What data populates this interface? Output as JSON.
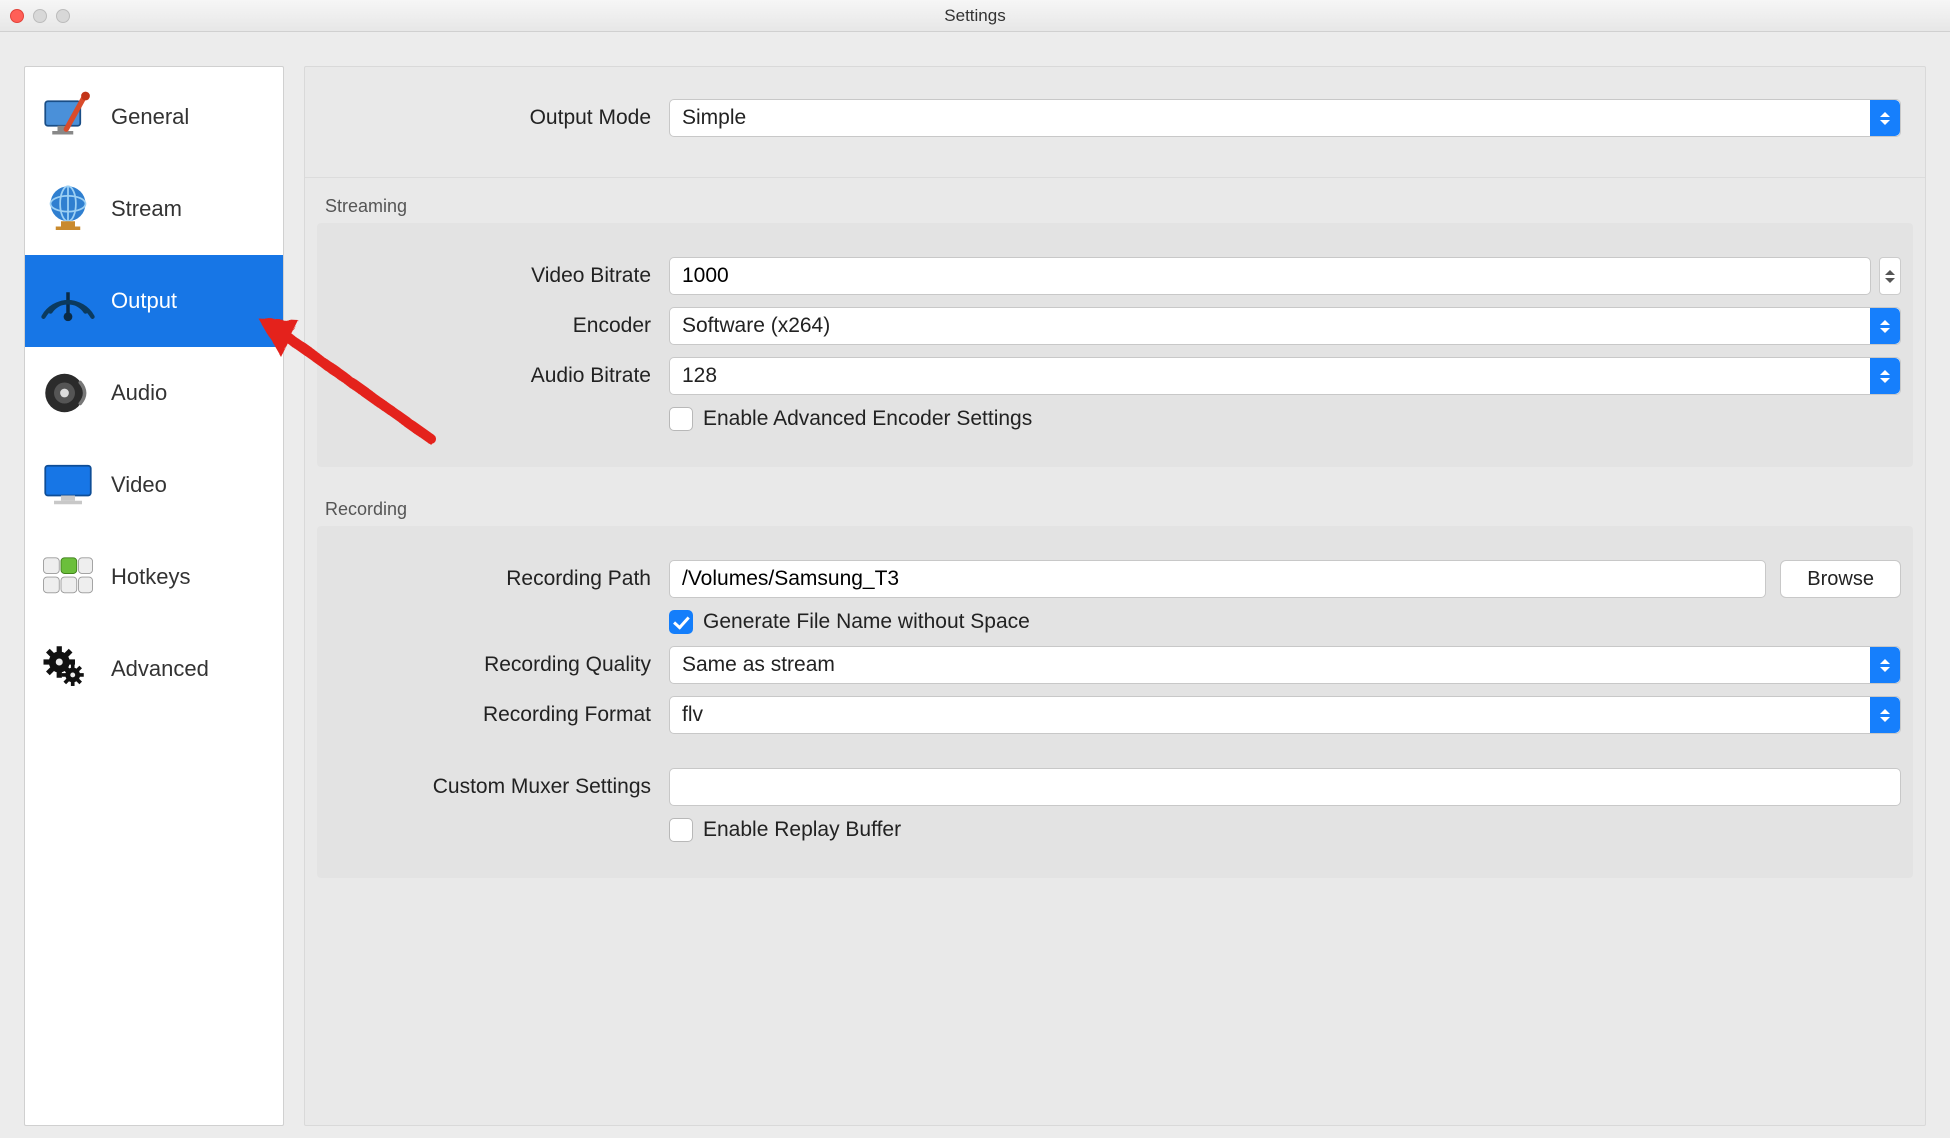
{
  "window": {
    "title": "Settings"
  },
  "sidebar": {
    "items": [
      {
        "label": "General"
      },
      {
        "label": "Stream"
      },
      {
        "label": "Output",
        "active": true
      },
      {
        "label": "Audio"
      },
      {
        "label": "Video"
      },
      {
        "label": "Hotkeys"
      },
      {
        "label": "Advanced"
      }
    ]
  },
  "output": {
    "output_mode_label": "Output Mode",
    "output_mode_value": "Simple",
    "streaming": {
      "title": "Streaming",
      "video_bitrate_label": "Video Bitrate",
      "video_bitrate_value": "1000",
      "encoder_label": "Encoder",
      "encoder_value": "Software (x264)",
      "audio_bitrate_label": "Audio Bitrate",
      "audio_bitrate_value": "128",
      "enable_advanced_label": "Enable Advanced Encoder Settings",
      "enable_advanced_checked": false
    },
    "recording": {
      "title": "Recording",
      "path_label": "Recording Path",
      "path_value": "/Volumes/Samsung_T3",
      "browse_label": "Browse",
      "gen_nospace_label": "Generate File Name without Space",
      "gen_nospace_checked": true,
      "quality_label": "Recording Quality",
      "quality_value": "Same as stream",
      "format_label": "Recording Format",
      "format_value": "flv",
      "muxer_label": "Custom Muxer Settings",
      "muxer_value": "",
      "replay_buffer_label": "Enable Replay Buffer",
      "replay_buffer_checked": false
    }
  }
}
